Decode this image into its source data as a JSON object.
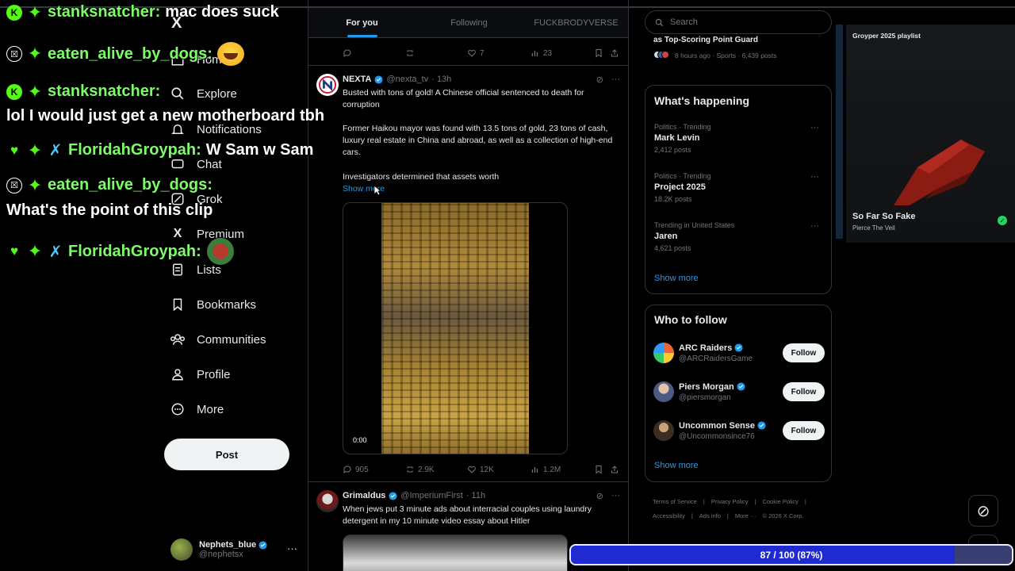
{
  "nav": {
    "logo": "X",
    "items": [
      {
        "label": "Home",
        "icon": "home-icon"
      },
      {
        "label": "Explore",
        "icon": "search-icon"
      },
      {
        "label": "Notifications",
        "icon": "bell-icon"
      },
      {
        "label": "Chat",
        "icon": "chat-icon"
      },
      {
        "label": "Grok",
        "icon": "grok-icon"
      },
      {
        "label": "Premium",
        "icon": "x-icon"
      },
      {
        "label": "Lists",
        "icon": "list-icon"
      },
      {
        "label": "Bookmarks",
        "icon": "bookmark-icon"
      },
      {
        "label": "Communities",
        "icon": "communities-icon"
      },
      {
        "label": "Profile",
        "icon": "person-icon"
      },
      {
        "label": "More",
        "icon": "more-circle-icon"
      }
    ],
    "post_label": "Post",
    "account": {
      "name": "Nephets_blue",
      "handle": "@nephetsx"
    }
  },
  "timeline": {
    "tabs": [
      "For you",
      "Following",
      "FUCKBRODYVERSE"
    ],
    "top_actions": {
      "replies": "",
      "reposts": "",
      "likes": "7",
      "views": "23"
    },
    "tweets": [
      {
        "author": "NEXTA",
        "handle": "@nexta_tv",
        "time": "· 13h",
        "text1": "Busted with tons of gold! A Chinese official sentenced to death for corruption",
        "text2": "Former Haikou mayor was found with 13.5 tons of gold, 23 tons of cash, luxury real estate in China and abroad, as well as a collection of high-end cars.",
        "text3": "Investigators determined that assets worth",
        "show_more": "Show more",
        "video_time": "0:00",
        "replies": "905",
        "reposts": "2.9K",
        "likes": "12K",
        "views": "1.2M"
      },
      {
        "author": "Grimaldus",
        "handle": "@ImperiumFirst",
        "time": "· 11h",
        "text1": "When jews put 3 minute ads about interracial couples using laundry detergent in my 10 minute video essay about Hitler"
      }
    ]
  },
  "right": {
    "search_placeholder": "Search",
    "pinned_trend": {
      "title": "as Top-Scoring Point Guard",
      "meta": "8 hours ago · Sports · 6,439 posts"
    },
    "happening_title": "What's happening",
    "trends": [
      {
        "meta": "Politics · Trending",
        "name": "Mark Levin",
        "count": "2,412 posts"
      },
      {
        "meta": "Politics · Trending",
        "name": "Project 2025",
        "count": "18.2K posts"
      },
      {
        "meta": "Trending in United States",
        "name": "Jaren",
        "count": "4,621 posts"
      }
    ],
    "show_more": "Show more",
    "who_title": "Who to follow",
    "follows": [
      {
        "name": "ARC Raiders",
        "handle": "@ARCRaidersGame",
        "button": "Follow",
        "avatar_color": "#1b1b1b"
      },
      {
        "name": "Piers Morgan",
        "handle": "@piersmorgan",
        "button": "Follow",
        "avatar_color": "#6b7fa6"
      },
      {
        "name": "Uncommon Sense",
        "handle": "@Uncommonsince76",
        "button": "Follow",
        "avatar_color": "#4a3a2a"
      }
    ],
    "footer": [
      "Terms of Service",
      "|",
      "Privacy Policy",
      "|",
      "Cookie Policy",
      "|",
      "Accessibility",
      "|",
      "Ads info",
      "|",
      "More ···",
      "© 2026 X Corp."
    ]
  },
  "music": {
    "playlist": "Groyper 2025 playlist",
    "song": "So Far So Fake",
    "artist": "Pierce The Veil"
  },
  "chat": [
    {
      "badges": [
        "K",
        "gem"
      ],
      "user": "stanksnatcher:",
      "msg": "mac does suck"
    },
    {
      "badges": [
        "alt",
        "gem"
      ],
      "user": "eaten_alive_by_dogs:",
      "msg": "",
      "emote": "laugh"
    },
    {
      "badges": [
        "K",
        "gem"
      ],
      "user": "stanksnatcher:",
      "msg": ""
    },
    {
      "line": "lol I would just get a new motherboard tbh"
    },
    {
      "badges": [
        "heart",
        "gem",
        "sword"
      ],
      "user": "FloridahGroypah:",
      "msg": "W Sam w Sam"
    },
    {
      "badges": [
        "alt",
        "gem"
      ],
      "user": "eaten_alive_by_dogs:",
      "msg": ""
    },
    {
      "line": "What's the point of this clip"
    },
    {
      "badges": [
        "heart",
        "gem",
        "sword"
      ],
      "user": "FloridahGroypah:",
      "msg": "",
      "emote": "frog"
    }
  ],
  "progress": {
    "label": "87 / 100 (87%)",
    "value": 0.87
  },
  "colors": {
    "accent": "#1d9bf0",
    "chat_user": "#7cfc66",
    "progress_fill": "#1f2bd0"
  }
}
